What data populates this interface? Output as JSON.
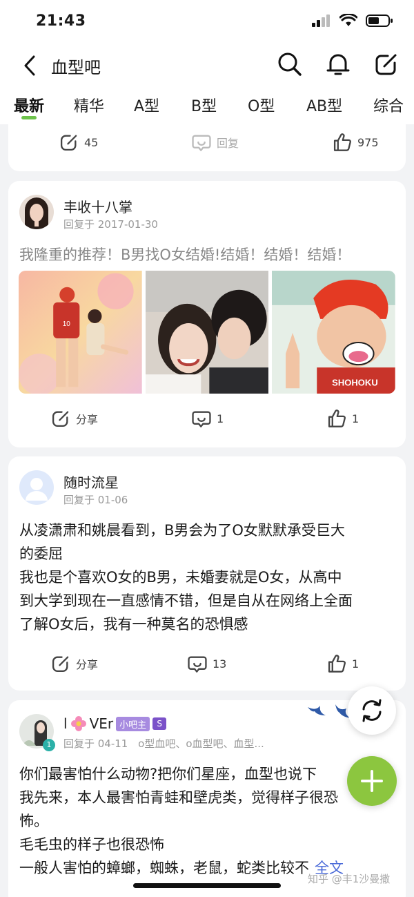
{
  "status": {
    "time": "21:43"
  },
  "header": {
    "title": "血型吧"
  },
  "tabs": [
    "最新",
    "精华",
    "A型",
    "B型",
    "O型",
    "AB型",
    "综合"
  ],
  "colors": {
    "accent": "#6cc24a",
    "fab": "#8cc63f",
    "link": "#4a6ad8",
    "admin_badge": "#a78be0"
  },
  "card1": {
    "share_count": "45",
    "reply_label": "回复",
    "like_count": "975"
  },
  "post1": {
    "user": "丰收十八掌",
    "date": "回复于 2017-01-30",
    "text": "我隆重的推荐！B男找O女结婚!结婚！结婚！结婚！",
    "share_label": "分享",
    "comments": "1",
    "likes": "1"
  },
  "post2": {
    "user": "随时流星",
    "date": "回复于 01-06",
    "line1": "从凌潇肃和姚晨看到，B男会为了O女默默承受巨大",
    "line2": "的委屈",
    "line3": "我也是个喜欢O女的B男，未婚妻就是O女，从高中",
    "line4": "到大学到现在一直感情不错，但是自从在网络上全面",
    "line5": "了解O女后，我有一种莫名的恐惧感",
    "share_label": "分享",
    "comments": "13",
    "likes": "1"
  },
  "post3": {
    "user_prefix": "l",
    "user_suffix": "VEr",
    "badge": "小吧主",
    "badge2": "S",
    "level": "1",
    "date": "回复于 04-11",
    "tags": "o型血吧、o血型吧、血型...",
    "line1": "你们最害怕什么动物?把你们星座，血型也说下",
    "line2": "我先来，本人最害怕青蛙和壁虎类，觉得样子很恐",
    "line3": "怖。",
    "line4": "毛毛虫的样子也很恐怖",
    "line5": "一般人害怕的蟑螂，蜘蛛，老鼠，蛇类比较不",
    "full_text": "全文"
  },
  "watermark": "知乎 @丰1沙曼撒"
}
